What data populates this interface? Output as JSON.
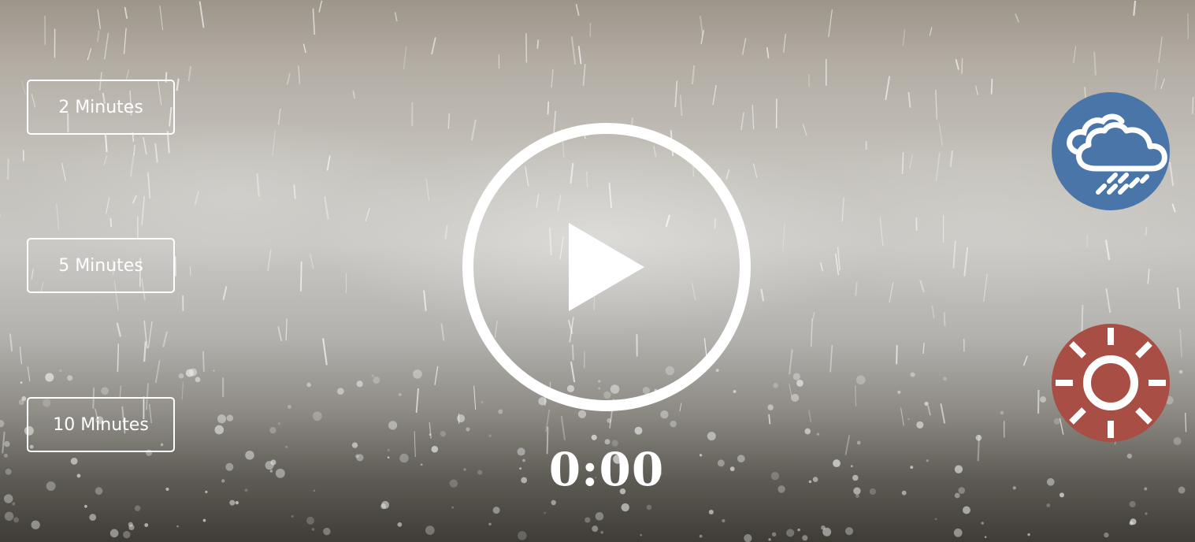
{
  "theme": {
    "rain_color": "#4a75a8",
    "sun_color": "#a84e44",
    "button_border": "#ffffff"
  },
  "duration_buttons": [
    {
      "label": "2 Minutes"
    },
    {
      "label": "5 Minutes"
    },
    {
      "label": "10 Minutes"
    }
  ],
  "player": {
    "play_icon": "play-icon",
    "timer": "0:00"
  },
  "weather_buttons": [
    {
      "icon": "rain-cloud-icon"
    },
    {
      "icon": "sun-icon"
    }
  ]
}
